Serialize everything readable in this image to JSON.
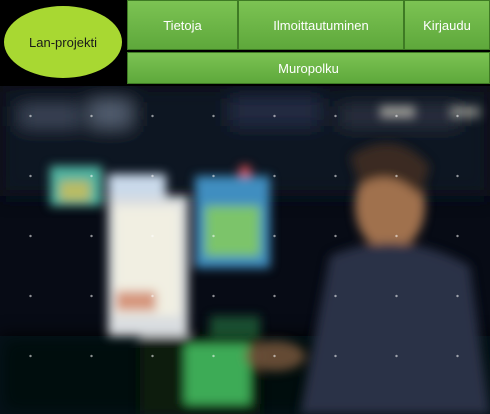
{
  "logo": {
    "label": "Lan-projekti"
  },
  "nav": {
    "items": [
      {
        "label": "Tietoja"
      },
      {
        "label": "Ilmoittautuminen"
      },
      {
        "label": "Kirjaudu"
      }
    ],
    "sub_label": "Muropolku"
  },
  "hero": {
    "description": "blurred photo of gamers at computers in a dark LAN event hall"
  },
  "colors": {
    "logo_green": "#a8d832",
    "nav_green": "#6cb647",
    "header_bg": "#000000"
  }
}
